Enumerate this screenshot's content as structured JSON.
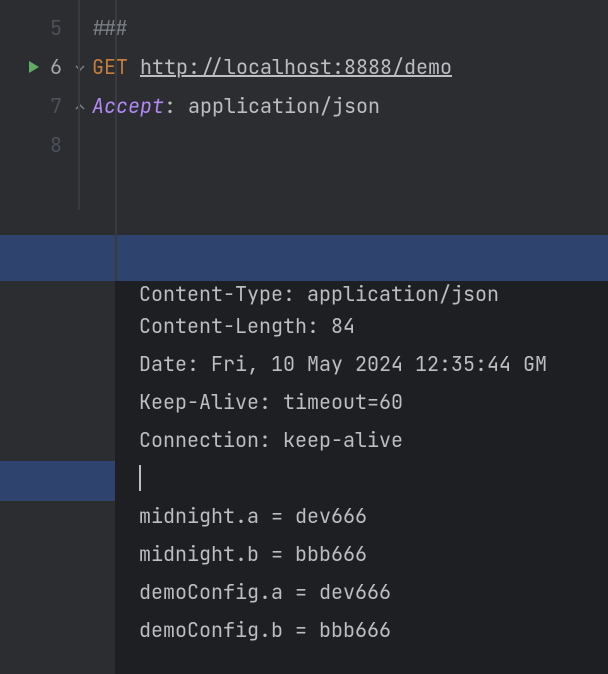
{
  "editor": {
    "lines": [
      {
        "num": "5",
        "active": false
      },
      {
        "num": "6",
        "active": true
      },
      {
        "num": "7",
        "active": false
      },
      {
        "num": "8",
        "active": false
      }
    ],
    "sep": "###",
    "method": "GET",
    "url": "http://localhost:8888/demo",
    "header_name": "Accept",
    "header_sep": ": ",
    "header_value": "application/json"
  },
  "response": {
    "cut_line": "Content-Type: application/json",
    "headers": [
      "Content-Length: 84",
      "Date: Fri, 10 May 2024 12:35:44 GM",
      "Keep-Alive: timeout=60",
      "Connection: keep-alive"
    ],
    "body": [
      "midnight.a = dev666",
      "midnight.b = bbb666",
      "demoConfig.a = dev666",
      "demoConfig.b = bbb666"
    ]
  }
}
